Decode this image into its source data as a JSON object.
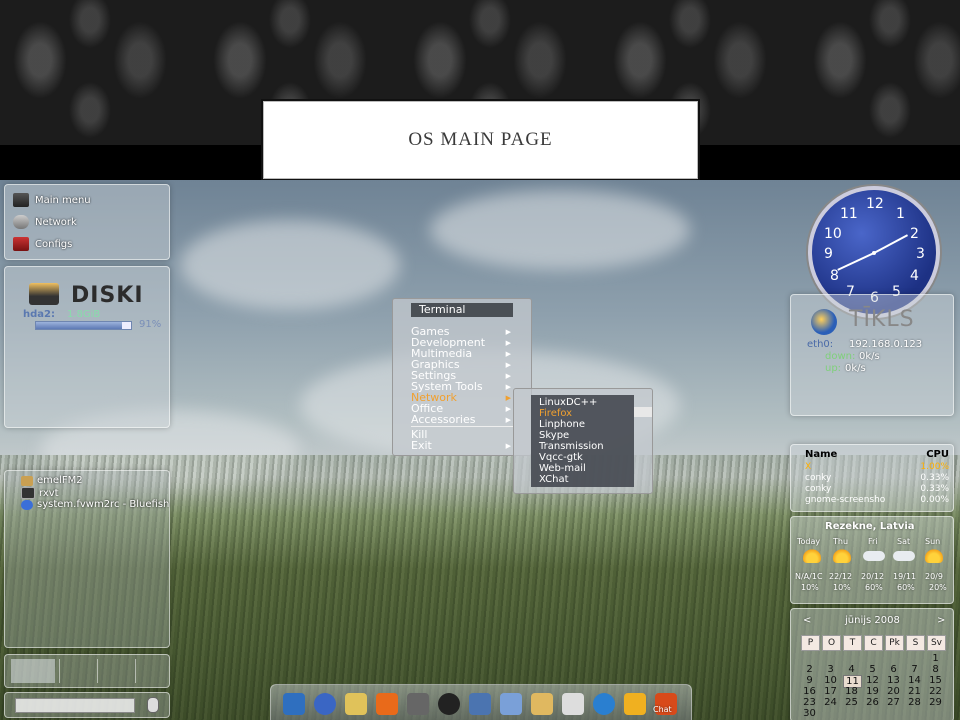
{
  "slide": {
    "title": "OS MAIN PAGE"
  },
  "launcher": [
    {
      "label": "Main menu",
      "icon": "monitor-icon"
    },
    {
      "label": "Network",
      "icon": "network-icon"
    },
    {
      "label": "Configs",
      "icon": "config-icon"
    }
  ],
  "disk": {
    "title": "DISKI",
    "drive": "hda2:",
    "size": "1.8GiB",
    "percent": "91%",
    "fill_fraction": 0.91
  },
  "start_menu": {
    "header": "Terminal",
    "items": [
      "Games",
      "Development",
      "Multimedia",
      "Graphics",
      "Settings",
      "System Tools",
      "Network",
      "Office",
      "Accessories"
    ],
    "highlighted": "Network",
    "footer": [
      "Kill",
      "Exit"
    ],
    "submenu": [
      "LinuxDC++",
      "Firefox",
      "Linphone",
      "Skype",
      "Transmission",
      "Vqcc-gtk",
      "Web-mail",
      "XChat"
    ],
    "submenu_highlighted": "Firefox"
  },
  "clock": {
    "numbers": [
      "12",
      "1",
      "2",
      "3",
      "4",
      "5",
      "6",
      "7",
      "8",
      "9",
      "10",
      "11"
    ]
  },
  "network": {
    "title": "TĪKLS",
    "interface": "eth0:",
    "ip": "192.168.0.123",
    "down_label": "down:",
    "down": "0k/s",
    "up_label": "up:",
    "up": "0k/s"
  },
  "processes": {
    "headers": {
      "name": "Name",
      "cpu": "CPU"
    },
    "rows": [
      {
        "name": "X",
        "cpu": "1.00%"
      },
      {
        "name": "conky",
        "cpu": "0.33%"
      },
      {
        "name": "conky",
        "cpu": "0.33%"
      },
      {
        "name": "gnome-screensho",
        "cpu": "0.00%"
      }
    ]
  },
  "weather": {
    "location": "Rezekne, Latvia",
    "days": [
      "Today",
      "Thu",
      "Fri",
      "Sat",
      "Sun"
    ],
    "temps": [
      "N/A/1C",
      "22/12",
      "20/12",
      "19/11",
      "20/9"
    ],
    "precip": [
      "10%",
      "10%",
      "60%",
      "60%",
      "20%"
    ],
    "icons": [
      "sun-icon",
      "sun-icon",
      "rain-cloud-icon",
      "rain-cloud-icon",
      "sun-icon"
    ]
  },
  "calendar": {
    "prev": "<",
    "next": ">",
    "month": "jūnijs 2008",
    "weekdays": [
      "P",
      "O",
      "T",
      "C",
      "Pk",
      "S",
      "Sv"
    ],
    "weeks": [
      [
        "",
        "",
        "",
        "",
        "",
        "",
        "1"
      ],
      [
        "2",
        "3",
        "4",
        "5",
        "6",
        "7",
        "8"
      ],
      [
        "9",
        "10",
        "11",
        "12",
        "13",
        "14",
        "15"
      ],
      [
        "16",
        "17",
        "18",
        "19",
        "20",
        "21",
        "22"
      ],
      [
        "23",
        "24",
        "25",
        "26",
        "27",
        "28",
        "29"
      ],
      [
        "30",
        "",
        "",
        "",
        "",
        "",
        ""
      ]
    ],
    "today": "11"
  },
  "tray": [
    {
      "label": "emelFM2",
      "icon": "file-manager-icon"
    },
    {
      "label": "rxvt",
      "icon": "terminal-icon"
    },
    {
      "label": "system.fvwm2rc - Bluefish",
      "icon": "editor-icon"
    }
  ],
  "dock": {
    "icons": [
      "arch-icon",
      "globe-icon",
      "folder-icon",
      "firefox-icon",
      "tool-icon",
      "penguin-icon",
      "screen-icon",
      "plane-icon",
      "book-icon",
      "chat-icon",
      "skype-icon",
      "qq-icon",
      "xchat-icon"
    ],
    "chat_label": "Chat"
  }
}
